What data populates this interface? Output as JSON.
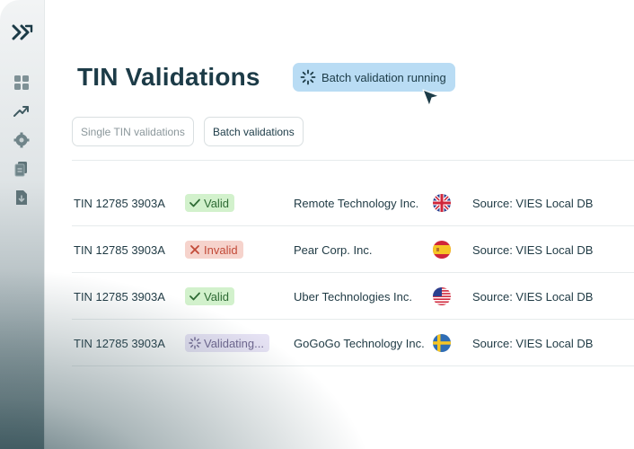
{
  "page": {
    "title": "TIN Validations",
    "batch_status": "Batch validation running"
  },
  "tabs": [
    {
      "label": "Single TIN validations"
    },
    {
      "label": "Batch validations"
    }
  ],
  "rows": [
    {
      "tin": "TIN 12785 3903A",
      "status": "Valid",
      "status_type": "valid",
      "company": "Remote Technology Inc.",
      "flag": "uk-flag-icon",
      "source": "Source: VIES Local DB"
    },
    {
      "tin": "TIN 12785 3903A",
      "status": "Invalid",
      "status_type": "invalid",
      "company": "Pear Corp. Inc.",
      "flag": "spain-flag-icon",
      "source": "Source: VIES Local DB"
    },
    {
      "tin": "TIN 12785 3903A",
      "status": "Valid",
      "status_type": "valid",
      "company": "Uber Technologies Inc.",
      "flag": "us-flag-icon",
      "source": "Source: VIES Local DB"
    },
    {
      "tin": "TIN 12785 3903A",
      "status": "Validating...",
      "status_type": "validating",
      "company": "GoGoGo Technology Inc.",
      "flag": "sweden-flag-icon",
      "source": "Source: VIES Local DB"
    }
  ],
  "sidebar": {
    "icons": [
      "dashboard-icon",
      "trending-icon",
      "settings-gear-icon",
      "documents-icon",
      "file-download-icon"
    ]
  },
  "colors": {
    "valid_bg": "#d2f1cc",
    "invalid_bg": "#f6d3cc",
    "validating_bg": "#e6e2f4",
    "pill_bg": "#b9dcf4",
    "text_dark": "#1c3b47"
  }
}
